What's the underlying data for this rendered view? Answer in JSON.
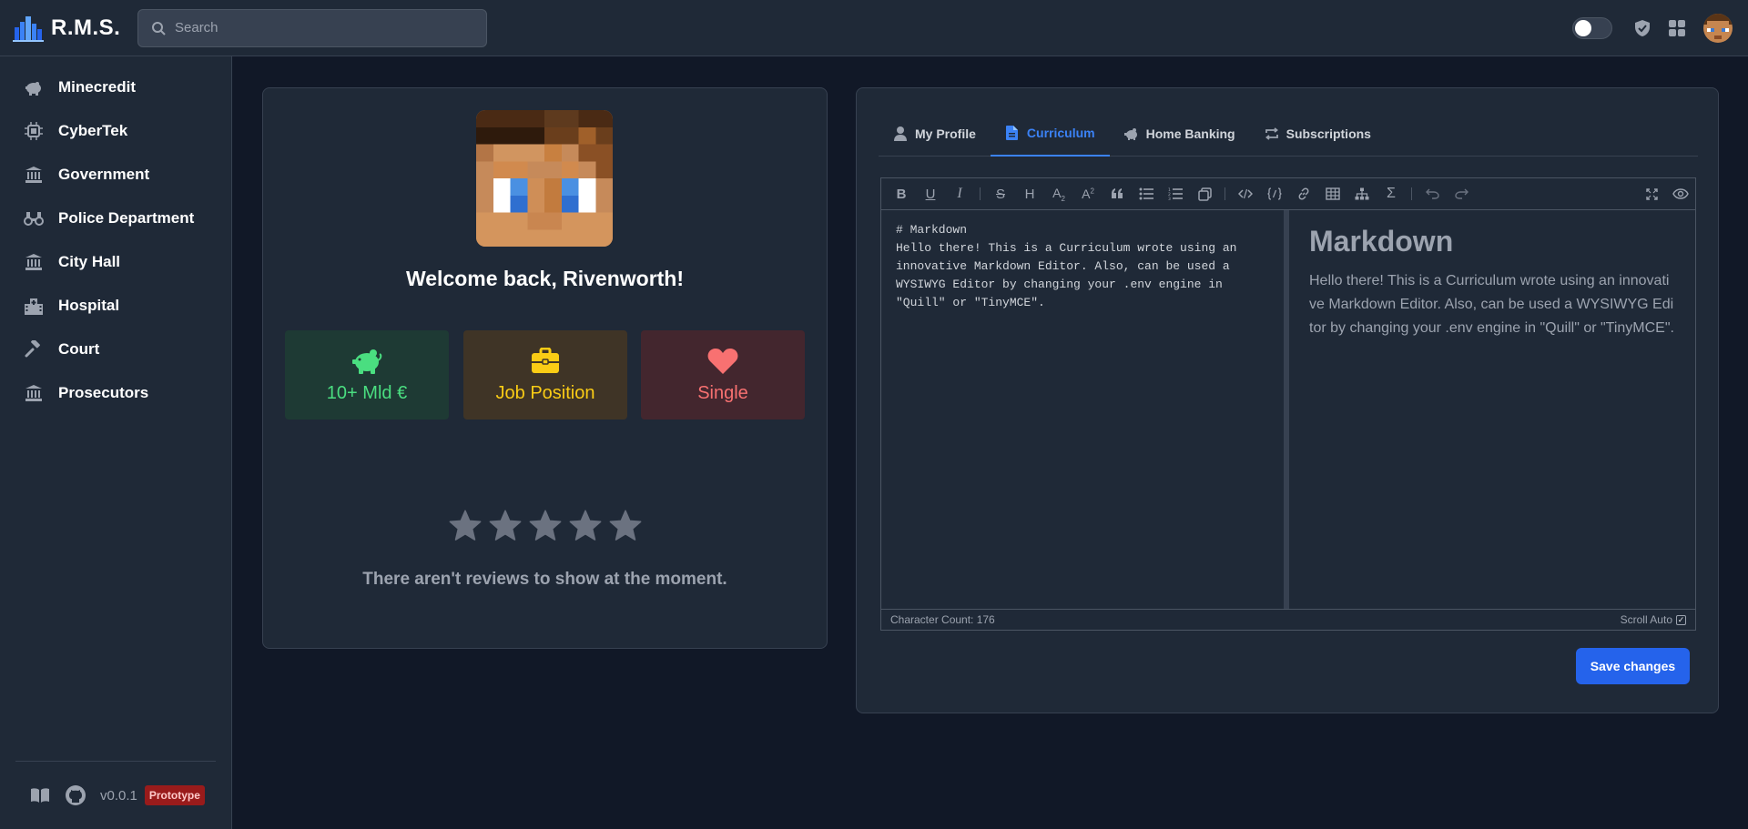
{
  "app": {
    "name": "R.M.S."
  },
  "search": {
    "placeholder": "Search"
  },
  "topbar": {
    "icons": [
      "theme-toggle",
      "shield-check-icon",
      "apps-grid-icon",
      "user-avatar"
    ]
  },
  "sidebar": {
    "items": [
      {
        "label": "Minecredit",
        "icon": "piggy-bank-icon"
      },
      {
        "label": "CyberTek",
        "icon": "chip-icon"
      },
      {
        "label": "Government",
        "icon": "landmark-icon"
      },
      {
        "label": "Police Department",
        "icon": "binoculars-icon"
      },
      {
        "label": "City Hall",
        "icon": "landmark-icon"
      },
      {
        "label": "Hospital",
        "icon": "hospital-icon"
      },
      {
        "label": "Court",
        "icon": "gavel-icon"
      },
      {
        "label": "Prosecutors",
        "icon": "landmark-icon"
      }
    ],
    "footer": {
      "version": "v0.0.1",
      "badge": "Prototype"
    }
  },
  "profile": {
    "welcome": "Welcome back, Rivenworth!",
    "stats": {
      "money": "10+ Mld €",
      "job": "Job Position",
      "relationship": "Single"
    },
    "rating_stars": 0,
    "rating_max": 5,
    "no_reviews": "There aren't reviews to show at the moment."
  },
  "tabs": [
    {
      "label": "My Profile",
      "icon": "user-icon",
      "active": false
    },
    {
      "label": "Curriculum",
      "icon": "document-icon",
      "active": true
    },
    {
      "label": "Home Banking",
      "icon": "piggy-bank-icon",
      "active": false
    },
    {
      "label": "Subscriptions",
      "icon": "repeat-icon",
      "active": false
    }
  ],
  "editor": {
    "source": "# Markdown\nHello there! This is a Curriculum wrote using an innovative Markdown Editor. Also, can be used a WYSIWYG Editor by changing your .env engine in \"Quill\" or \"TinyMCE\".",
    "preview_heading": "Markdown",
    "preview_text": "Hello there! This is a Curriculum wrote using an innovative Markdown Editor. Also, can be used a WYSIWYG Editor by changing your .env engine in \"Quill\" or \"TinyMCE\".",
    "character_count": "Character Count: 176",
    "scroll_auto": "Scroll Auto"
  },
  "actions": {
    "save": "Save changes"
  },
  "colors": {
    "accent": "#2563eb",
    "money": "#4ade80",
    "job": "#facc15",
    "relationship": "#f87171",
    "prototype_badge": "#991b1b"
  }
}
